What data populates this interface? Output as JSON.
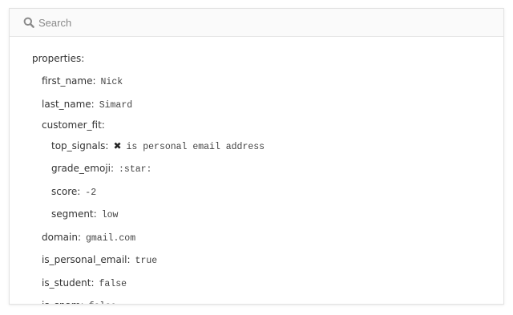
{
  "search": {
    "placeholder": "Search"
  },
  "properties": {
    "label": "properties:",
    "first_name": {
      "key": "first_name:",
      "value": "Nick"
    },
    "last_name": {
      "key": "last_name:",
      "value": "Simard"
    },
    "customer_fit": {
      "key": "customer_fit:",
      "top_signals": {
        "key": "top_signals:",
        "icon": "x-mark-icon",
        "value": "is personal email address"
      },
      "grade_emoji": {
        "key": "grade_emoji:",
        "value": ":star:"
      },
      "score": {
        "key": "score:",
        "value": "-2"
      },
      "segment": {
        "key": "segment:",
        "value": "low"
      }
    },
    "domain": {
      "key": "domain:",
      "value": "gmail.com"
    },
    "is_personal_email": {
      "key": "is_personal_email:",
      "value": "true"
    },
    "is_student": {
      "key": "is_student:",
      "value": "false"
    },
    "is_spam": {
      "key": "is_spam:",
      "value": "false"
    }
  }
}
